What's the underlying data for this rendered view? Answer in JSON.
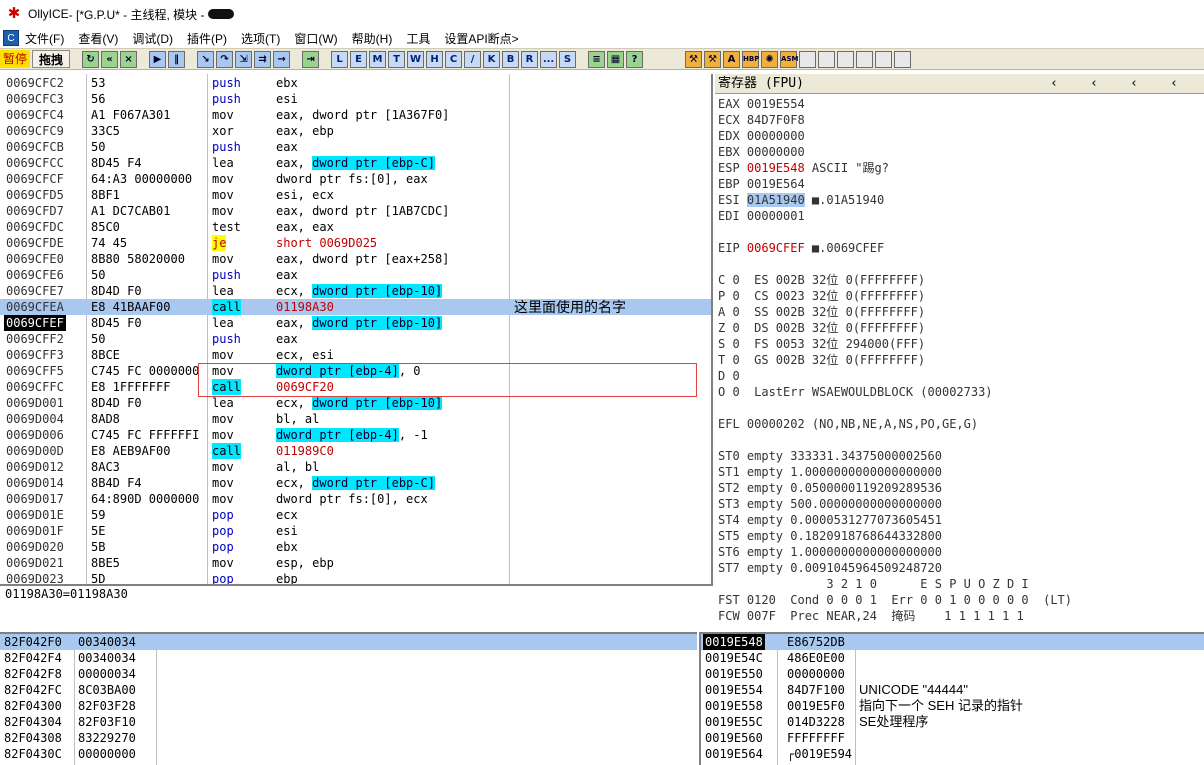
{
  "title": {
    "app": "OllyICE",
    "rest": " - [*G.P.U* - 主线程, 模块 - "
  },
  "menu": [
    "文件(F)",
    "查看(V)",
    "调试(D)",
    "插件(P)",
    "选项(T)",
    "窗口(W)",
    "帮助(H)",
    "工具",
    "设置API断点>"
  ],
  "toolbar": {
    "pause": "暂停",
    "drag": "拖拽",
    "buttons": [
      "L",
      "E",
      "M",
      "T",
      "W",
      "H",
      "C",
      "/",
      "K",
      "B",
      "R",
      "...",
      "S"
    ],
    "asm": "ASM",
    "hbp": "HBP"
  },
  "disasm": {
    "rows": [
      {
        "addr": "0069CFC2",
        "hex": "53",
        "mn": "push",
        "op": "ebx"
      },
      {
        "addr": "0069CFC3",
        "hex": "56",
        "mn": "push",
        "op": "esi"
      },
      {
        "addr": "0069CFC4",
        "hex": "A1 F067A301",
        "mn": "mov",
        "op": "eax, dword ptr [1A367F0]"
      },
      {
        "addr": "0069CFC9",
        "hex": "33C5",
        "mn": "xor",
        "op": "eax, ebp"
      },
      {
        "addr": "0069CFCB",
        "hex": "50",
        "mn": "push",
        "op": "eax"
      },
      {
        "addr": "0069CFCC",
        "hex": "8D45 F4",
        "mn": "lea",
        "op": "eax, ",
        "mem": "dword ptr [ebp-C]"
      },
      {
        "addr": "0069CFCF",
        "hex": "64:A3 00000000",
        "mn": "mov",
        "op": "dword ptr fs:[0], eax"
      },
      {
        "addr": "0069CFD5",
        "hex": "8BF1",
        "mn": "mov",
        "op": "esi, ecx"
      },
      {
        "addr": "0069CFD7",
        "hex": "A1 DC7CAB01",
        "mn": "mov",
        "op": "eax, dword ptr [1AB7CDC]"
      },
      {
        "addr": "0069CFDC",
        "hex": "85C0",
        "mn": "test",
        "op": "eax, eax"
      },
      {
        "addr": "0069CFDE",
        "hex": "74 45",
        "mn": "je",
        "op": "short 0069D025"
      },
      {
        "addr": "0069CFE0",
        "hex": "8B80 58020000",
        "mn": "mov",
        "op": "eax, dword ptr [eax+258]"
      },
      {
        "addr": "0069CFE6",
        "hex": "50",
        "mn": "push",
        "op": "eax"
      },
      {
        "addr": "0069CFE7",
        "hex": "8D4D F0",
        "mn": "lea",
        "op": "ecx, ",
        "mem": "dword ptr [ebp-10]"
      },
      {
        "addr": "0069CFEA",
        "hex": "E8 41BAAF00",
        "mn": "call",
        "op": "01198A30",
        "comment": "这里面使用的名字"
      },
      {
        "addr": "0069CFEF",
        "hex": "8D45 F0",
        "mn": "lea",
        "op": "eax, ",
        "mem": "dword ptr [ebp-10]"
      },
      {
        "addr": "0069CFF2",
        "hex": "50",
        "mn": "push",
        "op": "eax"
      },
      {
        "addr": "0069CFF3",
        "hex": "8BCE",
        "mn": "mov",
        "op": "ecx, esi"
      },
      {
        "addr": "0069CFF5",
        "hex": "C745 FC 0000000",
        "mn": "mov",
        "op": "",
        "mem": "dword ptr [ebp-4]",
        "tail": ", 0"
      },
      {
        "addr": "0069CFFC",
        "hex": "E8 1FFFFFFF",
        "mn": "call",
        "op": "0069CF20"
      },
      {
        "addr": "0069D001",
        "hex": "8D4D F0",
        "mn": "lea",
        "op": "ecx, ",
        "mem": "dword ptr [ebp-10]"
      },
      {
        "addr": "0069D004",
        "hex": "8AD8",
        "mn": "mov",
        "op": "bl, al"
      },
      {
        "addr": "0069D006",
        "hex": "C745 FC FFFFFFI",
        "mn": "mov",
        "op": "",
        "mem": "dword ptr [ebp-4]",
        "tail": ", -1"
      },
      {
        "addr": "0069D00D",
        "hex": "E8 AEB9AF00",
        "mn": "call",
        "op": "011989C0"
      },
      {
        "addr": "0069D012",
        "hex": "8AC3",
        "mn": "mov",
        "op": "al, bl"
      },
      {
        "addr": "0069D014",
        "hex": "8B4D F4",
        "mn": "mov",
        "op": "ecx, ",
        "mem": "dword ptr [ebp-C]"
      },
      {
        "addr": "0069D017",
        "hex": "64:890D 0000000",
        "mn": "mov",
        "op": "dword ptr fs:[0], ecx"
      },
      {
        "addr": "0069D01E",
        "hex": "59",
        "mn": "pop",
        "op": "ecx"
      },
      {
        "addr": "0069D01F",
        "hex": "5E",
        "mn": "pop",
        "op": "esi"
      },
      {
        "addr": "0069D020",
        "hex": "5B",
        "mn": "pop",
        "op": "ebx"
      },
      {
        "addr": "0069D021",
        "hex": "8BE5",
        "mn": "mov",
        "op": "esp, ebp"
      },
      {
        "addr": "0069D023",
        "hex": "5D",
        "mn": "pop",
        "op": "ebp"
      }
    ],
    "info": "01198A30=01198A30"
  },
  "registers": {
    "header": "寄存器 (FPU)",
    "lines": [
      "EAX 0019E554",
      "ECX 84D7F0F8",
      "EDX 00000000",
      "EBX 00000000",
      "ESP 0019E548 ASCII \"踢g?",
      "EBP 0019E564",
      "ESI 01A51940 ■.01A51940",
      "EDI 00000001",
      "",
      "EIP 0069CFEF ■.0069CFEF",
      "",
      "C 0  ES 002B 32位 0(FFFFFFFF)",
      "P 0  CS 0023 32位 0(FFFFFFFF)",
      "A 0  SS 002B 32位 0(FFFFFFFF)",
      "Z 0  DS 002B 32位 0(FFFFFFFF)",
      "S 0  FS 0053 32位 294000(FFF)",
      "T 0  GS 002B 32位 0(FFFFFFFF)",
      "D 0",
      "O 0  LastErr WSAEWOULDBLOCK (00002733)",
      "",
      "EFL 00000202 (NO,NB,NE,A,NS,PO,GE,G)",
      "",
      "ST0 empty 333331.34375000002560",
      "ST1 empty 1.0000000000000000000",
      "ST2 empty 0.0500000119209289536",
      "ST3 empty 500.00000000000000000",
      "ST4 empty 0.0000531277073605451",
      "ST5 empty 0.1820918768644332800",
      "ST6 empty 1.0000000000000000000",
      "ST7 empty 0.0091045964509248720",
      "               3 2 1 0      E S P U O Z D I",
      "FST 0120  Cond 0 0 0 1  Err 0 0 1 0 0 0 0 0  (LT)",
      "FCW 007F  Prec NEAR,24  掩码    1 1 1 1 1 1"
    ]
  },
  "dump": {
    "rows": [
      {
        "addr": "82F042F0",
        "val": "00340034"
      },
      {
        "addr": "82F042F4",
        "val": "00340034"
      },
      {
        "addr": "82F042F8",
        "val": "00000034"
      },
      {
        "addr": "82F042FC",
        "val": "8C03BA00"
      },
      {
        "addr": "82F04300",
        "val": "82F03F28"
      },
      {
        "addr": "82F04304",
        "val": "82F03F10"
      },
      {
        "addr": "82F04308",
        "val": "83229270"
      },
      {
        "addr": "82F0430C",
        "val": "00000000"
      }
    ]
  },
  "stack": {
    "rows": [
      {
        "addr": "0019E548",
        "val": "E86752DB",
        "cm": ""
      },
      {
        "addr": "0019E54C",
        "val": "486E0E00",
        "cm": ""
      },
      {
        "addr": "0019E550",
        "val": "00000000",
        "cm": ""
      },
      {
        "addr": "0019E554",
        "val": "84D7F100",
        "cm": "UNICODE \"44444\""
      },
      {
        "addr": "0019E558",
        "val": "0019E5F0",
        "cm": "指向下一个 SEH 记录的指针"
      },
      {
        "addr": "0019E55C",
        "val": "014D3228",
        "cm": "SE处理程序"
      },
      {
        "addr": "0019E560",
        "val": "FFFFFFFF",
        "cm": ""
      },
      {
        "addr": "0019E564",
        "val": "┌0019E594",
        "cm": ""
      }
    ]
  },
  "colors": {
    "cyan": "#00e8ff",
    "yellow": "#ffff00",
    "red": "#c00000",
    "select": "#a8c8f0"
  }
}
